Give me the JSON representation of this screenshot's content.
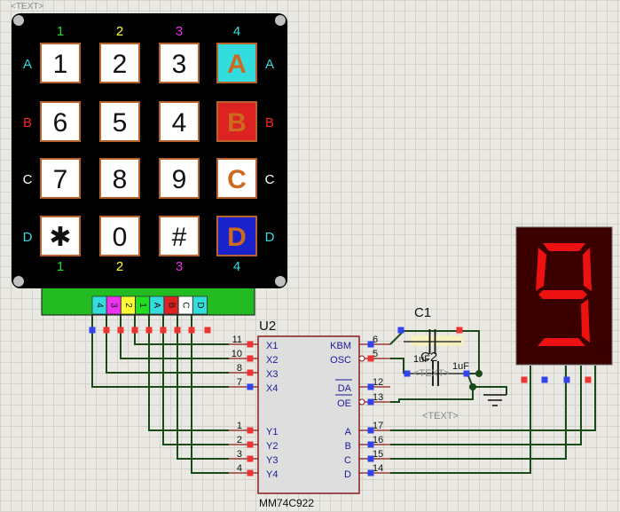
{
  "top_placeholder": "<TEXT>",
  "keypad": {
    "col_labels": [
      "1",
      "2",
      "3",
      "4"
    ],
    "col_label_colors": [
      "#22dd22",
      "#ffff33",
      "#ee33ee",
      "#33dddd"
    ],
    "row_labels": [
      "A",
      "B",
      "C",
      "D"
    ],
    "row_label_colors": [
      "#33dddd",
      "#ff2222",
      "#ffffff",
      "#33dddd"
    ],
    "keys": [
      [
        "1",
        "2",
        "3",
        "A"
      ],
      [
        "6",
        "5",
        "4",
        "B"
      ],
      [
        "7",
        "8",
        "9",
        "C"
      ],
      [
        "✱",
        "0",
        "#",
        "D"
      ]
    ],
    "accent_key_bg": [
      "#33dddd",
      "#dd2222",
      "#ffffff",
      "#1a22cc"
    ],
    "accent_key_fg": [
      "#cc6a1e",
      "#cc6a1e",
      "#cc6a1e",
      "#cc6a1e"
    ],
    "connector_pins": [
      "4",
      "3",
      "2",
      "1",
      "A",
      "B",
      "C",
      "D"
    ],
    "connector_pin_colors": [
      "#33dddd",
      "#ee33ee",
      "#ffff33",
      "#22dd22",
      "#33dddd",
      "#dd2222",
      "#ffffff",
      "#33dddd"
    ]
  },
  "ic": {
    "ref": "U2",
    "part": "MM74C922",
    "left_pins": [
      {
        "num": "11",
        "name": "X1"
      },
      {
        "num": "10",
        "name": "X2"
      },
      {
        "num": "8",
        "name": "X3"
      },
      {
        "num": "7",
        "name": "X4"
      },
      {
        "num": "1",
        "name": "Y1"
      },
      {
        "num": "2",
        "name": "Y2"
      },
      {
        "num": "3",
        "name": "Y3"
      },
      {
        "num": "4",
        "name": "Y4"
      }
    ],
    "right_pins": [
      {
        "num": "6",
        "name": "KBM"
      },
      {
        "num": "5",
        "name": "OSC"
      },
      {
        "num": "12",
        "name": "DA"
      },
      {
        "num": "13",
        "name": "OE"
      },
      {
        "num": "17",
        "name": "A"
      },
      {
        "num": "16",
        "name": "B"
      },
      {
        "num": "15",
        "name": "C"
      },
      {
        "num": "14",
        "name": "D"
      }
    ]
  },
  "capacitors": [
    {
      "ref": "C1",
      "value": "1uF"
    },
    {
      "ref": "C2",
      "value": "1uF"
    }
  ],
  "placeholders": [
    "<TEXT>",
    "<TEXT>"
  ],
  "display": {
    "digit": "9",
    "segment_on_color": "#ee1111",
    "segment_off_color": "#3a0000"
  },
  "colors": {
    "wire": "#1a4a1a",
    "pin_red": "#ee3333",
    "pin_blue": "#3344ee",
    "ic_outline": "#8b1a1a",
    "label_blue": "#1a1a99"
  }
}
